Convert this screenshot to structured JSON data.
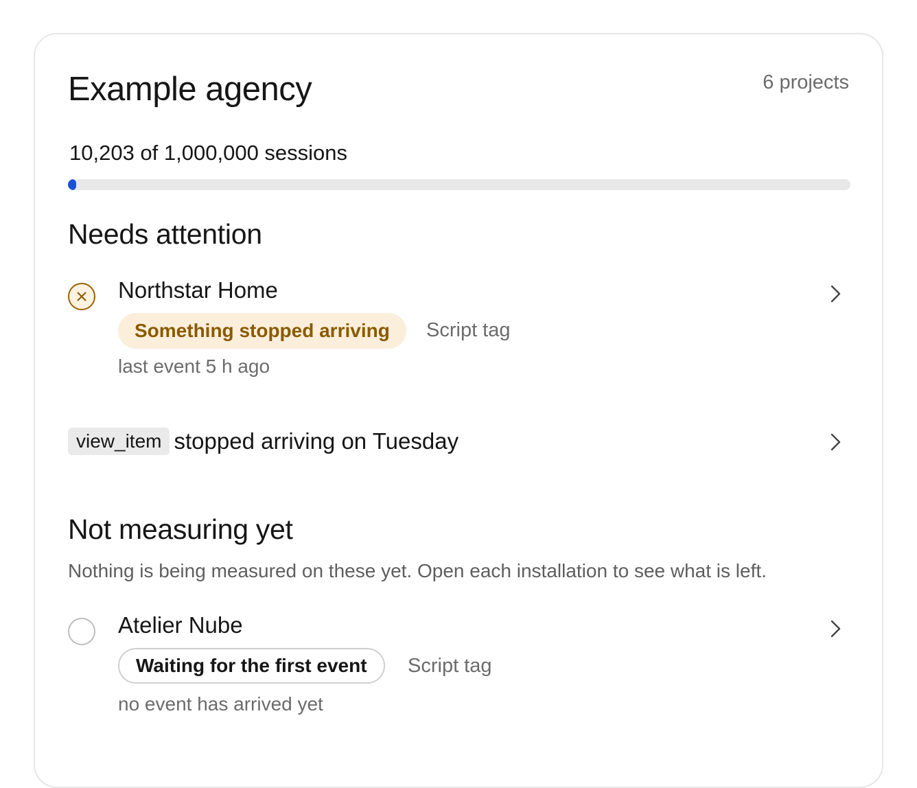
{
  "agency": {
    "title": "Example agency",
    "project_count": "6 projects"
  },
  "usage": {
    "sessions_text": "10,203 of 1,000,000 sessions",
    "used": 10203,
    "limit": 1000000,
    "accent_color": "#1a52d6"
  },
  "needs_attention": {
    "heading": "Needs attention",
    "project": {
      "name": "Northstar Home",
      "status_icon": "x-circle-icon",
      "status_label": "Something stopped arriving",
      "source": "Script tag",
      "meta": "last event 5 h ago",
      "status_color": "#8a5a00"
    },
    "event_alert": {
      "event_name": "view_item",
      "message": "stopped arriving on Tuesday"
    }
  },
  "not_measuring": {
    "heading": "Not measuring yet",
    "description": "Nothing is being measured on these yet. Open each installation to see what is left.",
    "project": {
      "name": "Atelier Nube",
      "status_icon": "empty-circle-icon",
      "status_label": "Waiting for the first event",
      "source": "Script tag",
      "meta": "no event has arrived yet"
    }
  }
}
